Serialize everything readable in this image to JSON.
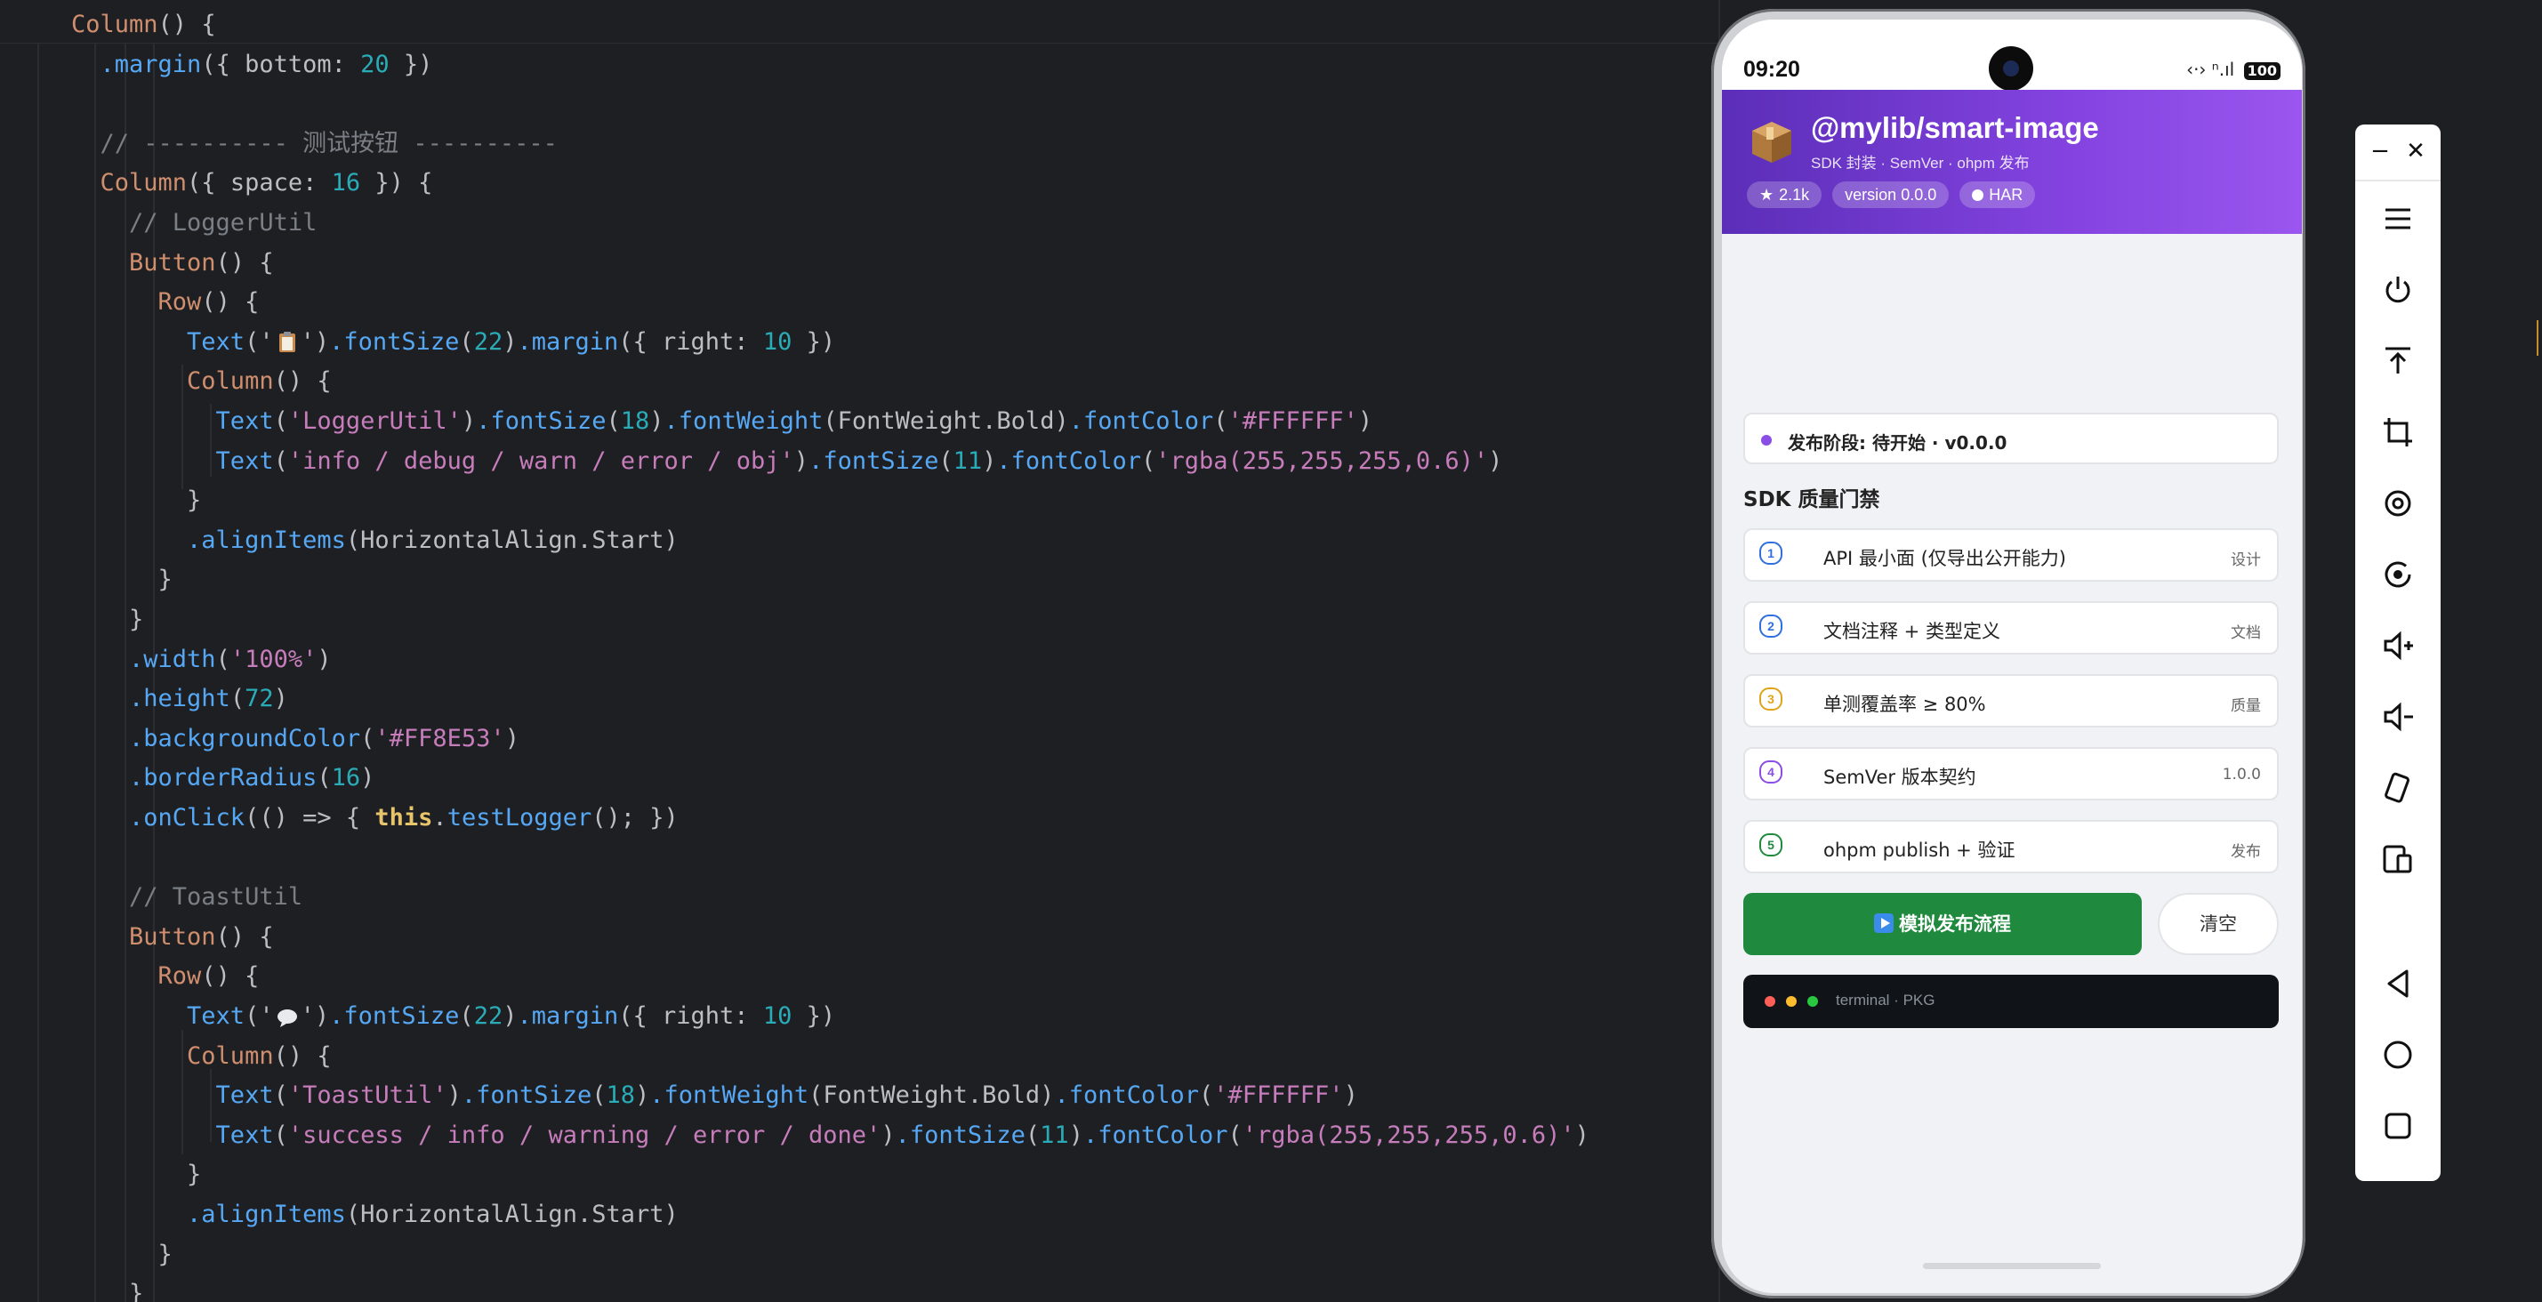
{
  "editor": {
    "lines": [
      [
        [
          "kw",
          "Column"
        ],
        [
          "id",
          "() {"
        ]
      ],
      [
        [
          "id",
          "  "
        ],
        [
          "fn",
          ".margin"
        ],
        [
          "id",
          "({ bottom: "
        ],
        [
          "num",
          "20"
        ],
        [
          "id",
          " })"
        ]
      ],
      [],
      [
        [
          "cm",
          "  // ---------- 测试按钮 ----------"
        ]
      ],
      [
        [
          "kw",
          "  Column"
        ],
        [
          "id",
          "({ space: "
        ],
        [
          "num",
          "16"
        ],
        [
          "id",
          " }) {"
        ]
      ],
      [
        [
          "cm",
          "    // LoggerUtil"
        ]
      ],
      [
        [
          "kw",
          "    Button"
        ],
        [
          "id",
          "() {"
        ]
      ],
      [
        [
          "kw",
          "      Row"
        ],
        [
          "id",
          "() {"
        ]
      ],
      [
        [
          "fn",
          "        Text"
        ],
        [
          "id",
          "('"
        ],
        [
          "emoji",
          "clipboard"
        ],
        [
          "id",
          "')"
        ],
        [
          "fn",
          ".fontSize"
        ],
        [
          "id",
          "("
        ],
        [
          "num",
          "22"
        ],
        [
          "id",
          ")"
        ],
        [
          "fn",
          ".margin"
        ],
        [
          "id",
          "({ right: "
        ],
        [
          "num",
          "10"
        ],
        [
          "id",
          " })"
        ]
      ],
      [
        [
          "kw",
          "        Column"
        ],
        [
          "id",
          "() {"
        ]
      ],
      [
        [
          "fn",
          "          Text"
        ],
        [
          "id",
          "("
        ],
        [
          "str",
          "'LoggerUtil'"
        ],
        [
          "id",
          ")"
        ],
        [
          "fn",
          ".fontSize"
        ],
        [
          "id",
          "("
        ],
        [
          "num",
          "18"
        ],
        [
          "id",
          ")"
        ],
        [
          "fn",
          ".fontWeight"
        ],
        [
          "id",
          "(FontWeight.Bold)"
        ],
        [
          "fn",
          ".fontColor"
        ],
        [
          "id",
          "("
        ],
        [
          "str",
          "'#FFFFFF'"
        ],
        [
          "id",
          ")"
        ]
      ],
      [
        [
          "fn",
          "          Text"
        ],
        [
          "id",
          "("
        ],
        [
          "str",
          "'info / debug / warn / error / obj'"
        ],
        [
          "id",
          ")"
        ],
        [
          "fn",
          ".fontSize"
        ],
        [
          "id",
          "("
        ],
        [
          "num",
          "11"
        ],
        [
          "id",
          ")"
        ],
        [
          "fn",
          ".fontColor"
        ],
        [
          "id",
          "("
        ],
        [
          "str",
          "'rgba(255,255,255,0.6)'"
        ],
        [
          "id",
          ")"
        ]
      ],
      [
        [
          "id",
          "        }"
        ]
      ],
      [
        [
          "fn",
          "        .alignItems"
        ],
        [
          "id",
          "(HorizontalAlign.Start)"
        ]
      ],
      [
        [
          "id",
          "      }"
        ]
      ],
      [
        [
          "id",
          "    }"
        ]
      ],
      [
        [
          "fn",
          "    .width"
        ],
        [
          "id",
          "("
        ],
        [
          "str",
          "'100%'"
        ],
        [
          "id",
          ")"
        ]
      ],
      [
        [
          "fn",
          "    .height"
        ],
        [
          "id",
          "("
        ],
        [
          "num",
          "72"
        ],
        [
          "id",
          ")"
        ]
      ],
      [
        [
          "fn",
          "    .backgroundColor"
        ],
        [
          "id",
          "("
        ],
        [
          "str",
          "'#FF8E53'"
        ],
        [
          "id",
          ")"
        ]
      ],
      [
        [
          "fn",
          "    .borderRadius"
        ],
        [
          "id",
          "("
        ],
        [
          "num",
          "16"
        ],
        [
          "id",
          ")"
        ]
      ],
      [
        [
          "fn",
          "    .onClick"
        ],
        [
          "id",
          "(() => { "
        ],
        [
          "this",
          "this"
        ],
        [
          "id",
          "."
        ],
        [
          "fn",
          "testLogger"
        ],
        [
          "id",
          "(); })"
        ]
      ],
      [],
      [
        [
          "cm",
          "    // ToastUtil"
        ]
      ],
      [
        [
          "kw",
          "    Button"
        ],
        [
          "id",
          "() {"
        ]
      ],
      [
        [
          "kw",
          "      Row"
        ],
        [
          "id",
          "() {"
        ]
      ],
      [
        [
          "fn",
          "        Text"
        ],
        [
          "id",
          "('"
        ],
        [
          "emoji",
          "speech"
        ],
        [
          "id",
          "')"
        ],
        [
          "fn",
          ".fontSize"
        ],
        [
          "id",
          "("
        ],
        [
          "num",
          "22"
        ],
        [
          "id",
          ")"
        ],
        [
          "fn",
          ".margin"
        ],
        [
          "id",
          "({ right: "
        ],
        [
          "num",
          "10"
        ],
        [
          "id",
          " })"
        ]
      ],
      [
        [
          "kw",
          "        Column"
        ],
        [
          "id",
          "() {"
        ]
      ],
      [
        [
          "fn",
          "          Text"
        ],
        [
          "id",
          "("
        ],
        [
          "str",
          "'ToastUtil'"
        ],
        [
          "id",
          ")"
        ],
        [
          "fn",
          ".fontSize"
        ],
        [
          "id",
          "("
        ],
        [
          "num",
          "18"
        ],
        [
          "id",
          ")"
        ],
        [
          "fn",
          ".fontWeight"
        ],
        [
          "id",
          "(FontWeight.Bold)"
        ],
        [
          "fn",
          ".fontColor"
        ],
        [
          "id",
          "("
        ],
        [
          "str",
          "'#FFFFFF'"
        ],
        [
          "id",
          ")"
        ]
      ],
      [
        [
          "fn",
          "          Text"
        ],
        [
          "id",
          "("
        ],
        [
          "str",
          "'success / info / warning / error / done'"
        ],
        [
          "id",
          ")"
        ],
        [
          "fn",
          ".fontSize"
        ],
        [
          "id",
          "("
        ],
        [
          "num",
          "11"
        ],
        [
          "id",
          ")"
        ],
        [
          "fn",
          ".fontColor"
        ],
        [
          "id",
          "("
        ],
        [
          "str",
          "'rgba(255,255,255,0.6)'"
        ],
        [
          "id",
          ")"
        ]
      ],
      [
        [
          "id",
          "        }"
        ]
      ],
      [
        [
          "fn",
          "        .alignItems"
        ],
        [
          "id",
          "(HorizontalAlign.Start)"
        ]
      ],
      [
        [
          "id",
          "      }"
        ]
      ],
      [
        [
          "id",
          "    }"
        ]
      ]
    ]
  },
  "phone": {
    "status": {
      "time": "09:20",
      "signal": "‹·›  ⁿ.ıl",
      "battery": "100"
    },
    "header": {
      "title": "@mylib/smart-image",
      "subtitle": "SDK 封装 · SemVer · ohpm 发布",
      "badges": [
        {
          "icon": "star-icon",
          "text": "2.1k"
        },
        {
          "icon": "",
          "text": "version 0.0.0"
        },
        {
          "icon": "dot-icon",
          "text": "HAR"
        }
      ]
    },
    "stage": {
      "text": "发布阶段: 待开始 · v0.0.0"
    },
    "section_title": "SDK 质量门禁",
    "gates": [
      {
        "num": "1",
        "label": "API 最小面 (仅导出公开能力)",
        "tag": "设计",
        "color": "#2f6fde"
      },
      {
        "num": "2",
        "label": "文档注释 + 类型定义",
        "tag": "文档",
        "color": "#2f6fde"
      },
      {
        "num": "3",
        "label": "单测覆盖率 ≥ 80%",
        "tag": "质量",
        "color": "#e0a31a"
      },
      {
        "num": "4",
        "label": "SemVer 版本契约",
        "tag": "1.0.0",
        "color": "#8a4de5"
      },
      {
        "num": "5",
        "label": "ohpm publish + 验证",
        "tag": "发布",
        "color": "#1f8a3d"
      }
    ],
    "primary_button": "模拟发布流程",
    "clear_button": "清空",
    "terminal": {
      "text": "terminal · PKG"
    }
  },
  "toolbar": {
    "minimize": "−",
    "close": "✕",
    "items": [
      "menu-icon",
      "power-icon",
      "pin-top-icon",
      "crop-icon",
      "rotate-icon",
      "screen-record-icon",
      "volume-up-icon",
      "volume-down-icon",
      "shake-icon",
      "multi-device-icon",
      "back-icon",
      "home-icon",
      "recents-icon"
    ]
  }
}
